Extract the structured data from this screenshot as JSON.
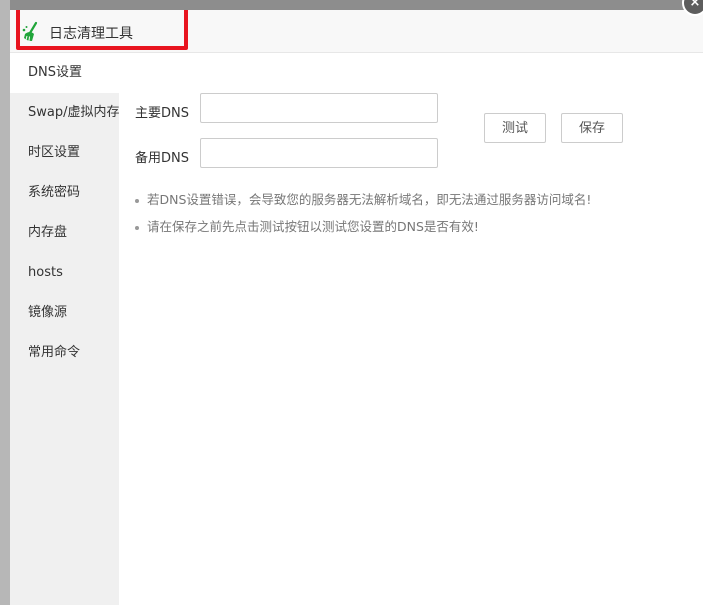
{
  "dialog": {
    "title": "日志清理工具",
    "title_icon": "broom-icon",
    "close_icon": "close-icon",
    "close_glyph": "×",
    "accent_green": "#20a53a",
    "highlight_color": "#e8141f"
  },
  "sidebar": {
    "items": [
      {
        "label": "DNS设置",
        "active": true
      },
      {
        "label": "Swap/虚拟内存"
      },
      {
        "label": "时区设置"
      },
      {
        "label": "系统密码"
      },
      {
        "label": "内存盘"
      },
      {
        "label": "hosts"
      },
      {
        "label": "镜像源"
      },
      {
        "label": "常用命令"
      }
    ]
  },
  "dns": {
    "primary_label": "主要DNS",
    "primary_value": "",
    "secondary_label": "备用DNS",
    "secondary_value": "",
    "test_button": "测试",
    "save_button": "保存",
    "tips": [
      "若DNS设置错误，会导致您的服务器无法解析域名，即无法通过服务器访问域名!",
      "请在保存之前先点击测试按钮以测试您设置的DNS是否有效!"
    ]
  }
}
